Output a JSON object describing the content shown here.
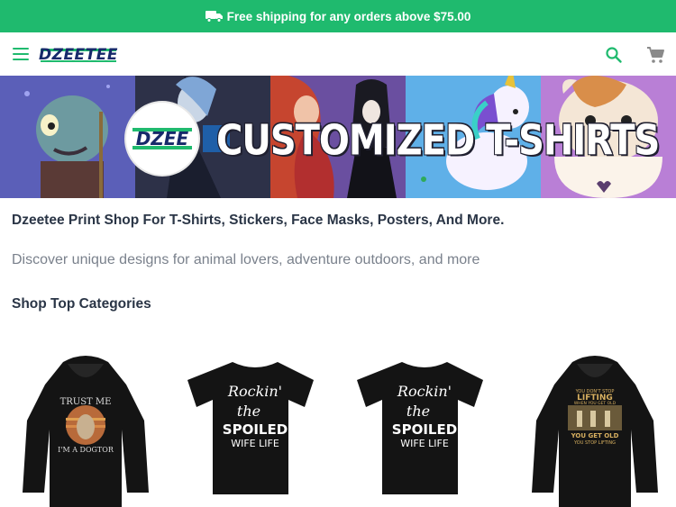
{
  "promo": {
    "text": "Free shipping for any orders above $75.00",
    "icon": "truck-icon"
  },
  "header": {
    "logo_text": "DZEETEE",
    "icons": [
      "menu-icon",
      "search-icon",
      "cart-icon"
    ]
  },
  "banner": {
    "title": "CUSTOMIZED T-SHIRTS",
    "logo_text": "DZEE"
  },
  "content": {
    "headline": "Dzeetee Print Shop For T-Shirts, Stickers, Face Masks, Posters, And More.",
    "subline": "Discover unique designs for animal lovers, adventure outdoors, and more",
    "section_title": "Shop Top Categories"
  },
  "products": [
    {
      "type": "hoodie",
      "lines": [
        "TRUST ME",
        "I'M A DOGTOR"
      ]
    },
    {
      "type": "tshirt",
      "lines": [
        "Rockin'",
        "the",
        "SPOILED",
        "WIFE LIFE"
      ]
    },
    {
      "type": "tshirt",
      "lines": [
        "Rockin'",
        "the",
        "SPOILED",
        "WIFE LIFE"
      ]
    },
    {
      "type": "hoodie",
      "lines": [
        "YOU DON'T STOP",
        "LIFTING",
        "WHEN YOU GET OLD",
        "YOU GET OLD",
        "YOU STOP LIFTING"
      ]
    }
  ],
  "colors": {
    "accent": "#1fba6e",
    "brand_navy": "#16296a",
    "text_dark": "#2a3546",
    "text_muted": "#7a818c"
  }
}
